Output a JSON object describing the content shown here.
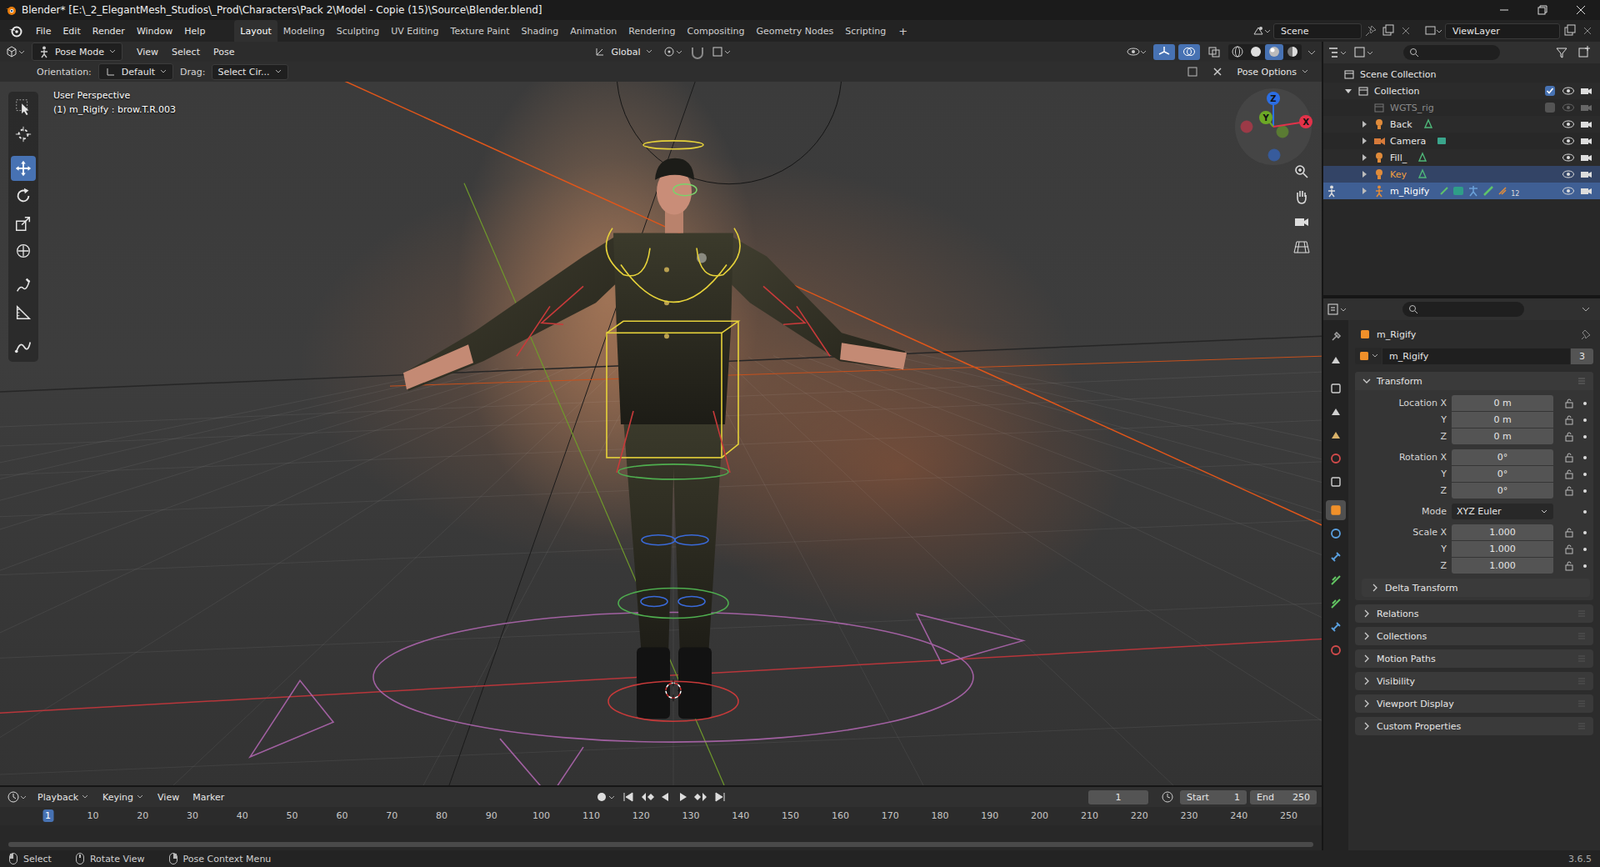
{
  "window": {
    "title": "Blender* [E:\\_2_ElegantMesh_Studios\\_Prod\\Characters\\Pack 2\\Model - Copie (15)\\Source\\Blender.blend]"
  },
  "menus": [
    "File",
    "Edit",
    "Render",
    "Window",
    "Help"
  ],
  "workspaces": [
    {
      "label": "Layout",
      "selected": true
    },
    {
      "label": "Modeling",
      "selected": false
    },
    {
      "label": "Sculpting",
      "selected": false
    },
    {
      "label": "UV Editing",
      "selected": false
    },
    {
      "label": "Texture Paint",
      "selected": false
    },
    {
      "label": "Shading",
      "selected": false
    },
    {
      "label": "Animation",
      "selected": false
    },
    {
      "label": "Rendering",
      "selected": false
    },
    {
      "label": "Compositing",
      "selected": false
    },
    {
      "label": "Geometry Nodes",
      "selected": false
    },
    {
      "label": "Scripting",
      "selected": false
    }
  ],
  "add_workspace": "+",
  "scene": "Scene",
  "view_layer": "ViewLayer",
  "viewport": {
    "mode": "Pose Mode",
    "menus": [
      "View",
      "Select",
      "Pose"
    ],
    "orientation_global": "Global",
    "toggles": [
      {
        "kind": "gizmo",
        "on": true
      },
      {
        "kind": "overlay",
        "on": true
      },
      {
        "kind": "xray",
        "on": false
      }
    ],
    "shading": [
      {
        "kind": "wireframe",
        "selected": false
      },
      {
        "kind": "solid",
        "selected": false
      },
      {
        "kind": "material",
        "selected": true
      },
      {
        "kind": "rendered",
        "selected": false
      }
    ],
    "orientation_label": "Orientation:",
    "orientation": "Default",
    "drag_label": "Drag:",
    "drag": "Select Cir...",
    "pose_options": "Pose Options",
    "view_name": "User Perspective",
    "active_info": "(1) m_Rigify : brow.T.R.003",
    "tools": [
      {
        "kind": "select",
        "selected": false
      },
      {
        "kind": "cursor",
        "selected": false
      },
      {
        "kind": "move",
        "selected": true
      },
      {
        "kind": "rotate",
        "selected": false
      },
      {
        "kind": "scale",
        "selected": false
      },
      {
        "kind": "transform",
        "selected": false
      },
      {
        "kind": "annotate",
        "selected": false
      },
      {
        "kind": "measure",
        "selected": false
      },
      {
        "kind": "pose",
        "selected": false
      }
    ],
    "gizmo": [
      {
        "label": "Z",
        "color": "#2c6ee3"
      },
      {
        "label": "Y",
        "color": "#6ca826"
      },
      {
        "label": "X",
        "color": "#e3324a"
      }
    ]
  },
  "outliner": {
    "root": "Scene Collection",
    "collection": {
      "label": "Collection",
      "expanded": true,
      "checked": true
    },
    "items": [
      {
        "label": "WGTS_rig",
        "kind": "collection",
        "hidden": true,
        "checked": false,
        "selected": false,
        "active": false,
        "badge": ""
      },
      {
        "label": "Back",
        "kind": "light",
        "hidden": false,
        "selected": false,
        "active": false,
        "badge": ""
      },
      {
        "label": "Camera",
        "kind": "camera",
        "hidden": false,
        "selected": false,
        "active": false,
        "badge": ""
      },
      {
        "label": "Fill_",
        "kind": "light",
        "hidden": false,
        "selected": false,
        "active": false,
        "badge": ""
      },
      {
        "label": "Key",
        "kind": "light",
        "hidden": false,
        "selected": true,
        "active": false,
        "badge": ""
      },
      {
        "label": "m_Rigify",
        "kind": "armature",
        "hidden": false,
        "selected": true,
        "active": true,
        "badge": "12"
      }
    ]
  },
  "properties": {
    "tabs": [
      {
        "kind": "tool",
        "selected": false
      },
      {
        "kind": "render",
        "selected": false
      },
      {
        "kind": "output",
        "selected": false
      },
      {
        "kind": "viewlayer",
        "selected": false
      },
      {
        "kind": "scene",
        "selected": false
      },
      {
        "kind": "world",
        "selected": false
      },
      {
        "kind": "collection",
        "selected": false
      },
      {
        "kind": "object",
        "selected": true
      },
      {
        "kind": "physics",
        "selected": false
      },
      {
        "kind": "objconstraints",
        "selected": false
      },
      {
        "kind": "data",
        "selected": false
      },
      {
        "kind": "bone",
        "selected": false
      },
      {
        "kind": "boneconstraints",
        "selected": false
      },
      {
        "kind": "texture",
        "selected": false
      }
    ],
    "object": "m_Rigify",
    "datablock": "m_Rigify",
    "users": "3",
    "panel": "Transform",
    "groups": [
      {
        "kind": "fields",
        "rows": [
          {
            "label": "Location X",
            "value": "0 m"
          },
          {
            "label": "Y",
            "value": "0 m"
          },
          {
            "label": "Z",
            "value": "0 m"
          }
        ]
      },
      {
        "kind": "fields",
        "rows": [
          {
            "label": "Rotation X",
            "value": "0°"
          },
          {
            "label": "Y",
            "value": "0°"
          },
          {
            "label": "Z",
            "value": "0°"
          }
        ]
      },
      {
        "kind": "dropdown",
        "label": "Mode",
        "value": "XYZ Euler"
      },
      {
        "kind": "fields",
        "rows": [
          {
            "label": "Scale X",
            "value": "1.000"
          },
          {
            "label": "Y",
            "value": "1.000"
          },
          {
            "label": "Z",
            "value": "1.000"
          }
        ]
      }
    ],
    "subpanel": "Delta Transform",
    "panels": [
      "Relations",
      "Collections",
      "Motion Paths",
      "Visibility",
      "Viewport Display",
      "Custom Properties"
    ]
  },
  "timeline": {
    "menus": [
      {
        "label": "Playback",
        "dropdown": true
      },
      {
        "label": "Keying",
        "dropdown": true
      },
      {
        "label": "View",
        "dropdown": false
      },
      {
        "label": "Marker",
        "dropdown": false
      }
    ],
    "frame": "1",
    "start_label": "Start",
    "start": "1",
    "end_label": "End",
    "end": "250",
    "ticks": [
      {
        "label": "1",
        "selected": true
      },
      {
        "label": "10",
        "selected": false
      },
      {
        "label": "20",
        "selected": false
      },
      {
        "label": "30",
        "selected": false
      },
      {
        "label": "40",
        "selected": false
      },
      {
        "label": "50",
        "selected": false
      },
      {
        "label": "60",
        "selected": false
      },
      {
        "label": "70",
        "selected": false
      },
      {
        "label": "80",
        "selected": false
      },
      {
        "label": "90",
        "selected": false
      },
      {
        "label": "100",
        "selected": false
      },
      {
        "label": "110",
        "selected": false
      },
      {
        "label": "120",
        "selected": false
      },
      {
        "label": "130",
        "selected": false
      },
      {
        "label": "140",
        "selected": false
      },
      {
        "label": "150",
        "selected": false
      },
      {
        "label": "160",
        "selected": false
      },
      {
        "label": "170",
        "selected": false
      },
      {
        "label": "180",
        "selected": false
      },
      {
        "label": "190",
        "selected": false
      },
      {
        "label": "200",
        "selected": false
      },
      {
        "label": "210",
        "selected": false
      },
      {
        "label": "220",
        "selected": false
      },
      {
        "label": "230",
        "selected": false
      },
      {
        "label": "240",
        "selected": false
      },
      {
        "label": "250",
        "selected": false
      }
    ]
  },
  "status": {
    "hints": [
      "Select",
      "Rotate View",
      "Pose Context Menu"
    ],
    "version": "3.6.5"
  }
}
